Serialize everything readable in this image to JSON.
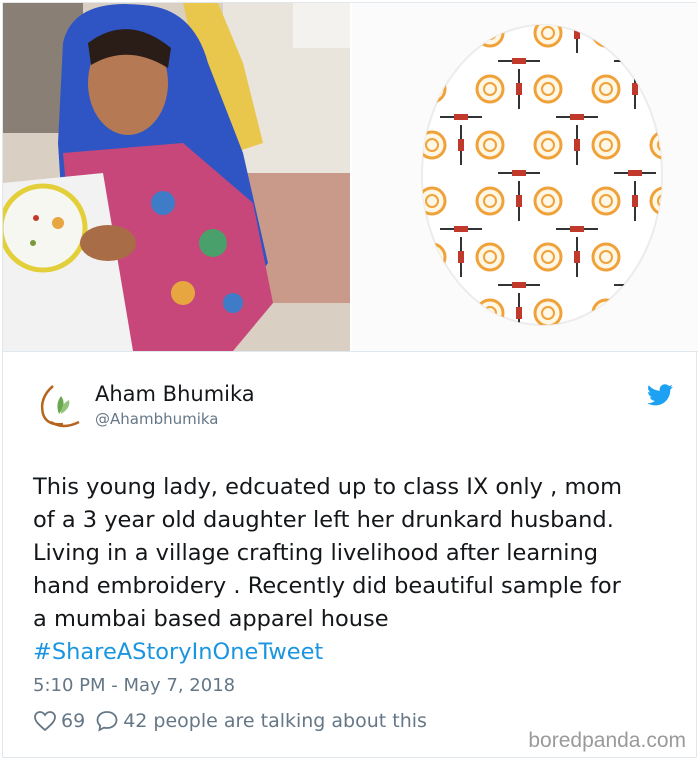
{
  "account": {
    "name": "Aham Bhumika",
    "handle": "@Ahambhumika"
  },
  "tweet": {
    "lines": [
      "This young lady, edcuated up to class IX only , mom",
      "of a 3 year old daughter left her drunkard husband.",
      "Living in a village crafting livelihood after learning",
      "hand embroidery . Recently did beautiful sample for",
      "a mumbai based apparel house"
    ],
    "hashtag": "#ShareAStoryInOneTweet",
    "timestamp": "5:10 PM - May 7, 2018"
  },
  "stats": {
    "likes": "69",
    "replies": "42 people are talking about this"
  },
  "watermark": "boredpanda.com",
  "colors": {
    "link_blue": "#1b95e0",
    "muted_gray": "#657786",
    "twitter_blue": "#1da1f2",
    "border": "#e1e8ed"
  },
  "icons": {
    "bird": "twitter-bird-icon",
    "heart": "heart-icon",
    "reply": "speech-bubble-icon",
    "avatar": "aham-bhumika-logo"
  }
}
